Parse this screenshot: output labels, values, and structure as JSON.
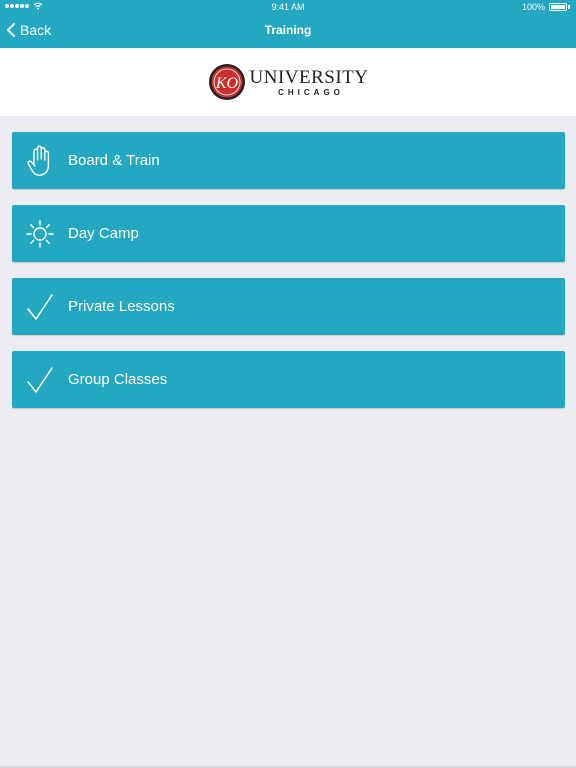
{
  "status_bar": {
    "time": "9:41 AM",
    "battery": "100%"
  },
  "nav": {
    "back_label": "Back",
    "title": "Training"
  },
  "brand": {
    "logo_mark": "KO",
    "name": "UNIVERSITY",
    "city": "CHICAGO"
  },
  "items": [
    {
      "label": "Board & Train",
      "icon": "hand-icon"
    },
    {
      "label": "Day Camp",
      "icon": "sun-icon"
    },
    {
      "label": "Private Lessons",
      "icon": "checkmark-icon"
    },
    {
      "label": "Group Classes",
      "icon": "checkmark-icon"
    }
  ],
  "colors": {
    "accent": "#24a7c0",
    "background": "#ebecf1",
    "logo_red": "#c9302c"
  }
}
